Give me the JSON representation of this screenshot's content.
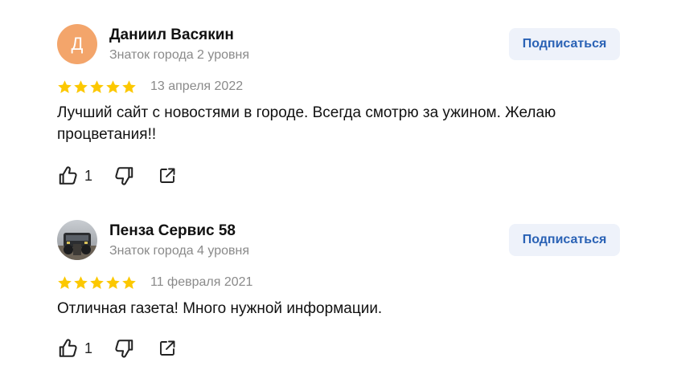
{
  "reviews": [
    {
      "author": {
        "initial": "Д",
        "name": "Даниил Васякин",
        "level": "Знаток города 2 уровня",
        "avatar_color": "#f3a56b"
      },
      "subscribe_label": "Подписаться",
      "rating": 5,
      "date": "13 апреля 2022",
      "text": "Лучший сайт с новостями в городе. Всегда смотрю за ужином. Желаю процветания!!",
      "likes": "1"
    },
    {
      "author": {
        "name": "Пенза Сервис 58",
        "level": "Знаток города 4 уровня"
      },
      "subscribe_label": "Подписаться",
      "rating": 5,
      "date": "11 февраля 2021",
      "text": "Отличная газета! Много нужной информации.",
      "likes": "1"
    }
  ],
  "colors": {
    "star": "#fcc800",
    "subscribe_text": "#2a62b5",
    "subscribe_bg": "#eef2fa",
    "secondary_text": "#8a8a8a"
  },
  "icons": [
    "thumbs-up-icon",
    "thumbs-down-icon",
    "share-icon",
    "star-icon"
  ]
}
